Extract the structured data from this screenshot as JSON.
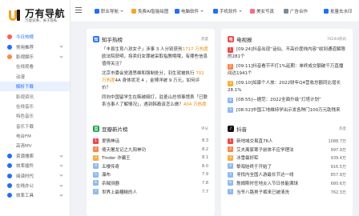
{
  "brand": {
    "title": "万有导航",
    "subtitle": "万能说事，关于隐私"
  },
  "sidebar": [
    {
      "label": "今日热榜",
      "color": "#ff5c5c",
      "kind": "top",
      "state": "active"
    },
    {
      "label": "常用推荐",
      "color": "#1e6fff",
      "kind": "top",
      "state": ""
    },
    {
      "label": "影视娱乐",
      "color": "#ff8a3d",
      "kind": "top",
      "state": ""
    },
    {
      "label": "在线观看",
      "kind": "sub",
      "state": ""
    },
    {
      "label": "动漫",
      "kind": "sub",
      "state": ""
    },
    {
      "label": "解析下载",
      "kind": "sub",
      "state": "highlight"
    },
    {
      "label": "影视资讯",
      "kind": "sub",
      "state": ""
    },
    {
      "label": "在线音乐",
      "kind": "sub",
      "state": ""
    },
    {
      "label": "特色音乐",
      "kind": "sub",
      "state": ""
    },
    {
      "label": "音乐下载",
      "kind": "sub",
      "state": ""
    },
    {
      "label": "电台FM",
      "kind": "sub",
      "state": ""
    },
    {
      "label": "高清MV",
      "kind": "sub",
      "state": ""
    },
    {
      "label": "资源搜索",
      "color": "#1e6fff",
      "kind": "top",
      "state": ""
    },
    {
      "label": "效率插件",
      "color": "#1e6fff",
      "kind": "top",
      "state": ""
    },
    {
      "label": "阅读时代",
      "color": "#1e6fff",
      "kind": "top",
      "state": ""
    },
    {
      "label": "在线办公",
      "color": "#1e6fff",
      "kind": "top",
      "state": ""
    },
    {
      "label": "效率工具",
      "color": "#1e6fff",
      "kind": "top",
      "state": ""
    }
  ],
  "nav": [
    {
      "label": "职业导航",
      "color": "#1e6fff",
      "caret": true
    },
    {
      "label": "免费AI智能绘图",
      "color": "#f5a623",
      "caret": false
    },
    {
      "label": "电脑软件",
      "color": "#1e6fff",
      "caret": true
    },
    {
      "label": "手机软件",
      "color": "#1e6fff",
      "caret": true
    },
    {
      "label": "美女写真",
      "color": "#ff6b8a",
      "caret": false
    },
    {
      "label": "广告合作",
      "color": "#7b8a9a",
      "caret": false
    },
    {
      "label": "批量去水印",
      "color": "#1e6fff",
      "caret": false
    }
  ],
  "zhihu": {
    "title": "知乎热榜",
    "meta": "热度",
    "icon": "知",
    "items": [
      {
        "text": "「丰县生育八孩女子」涉事 3 人分别获刑",
        "hot": "1717 万热度",
        "text2": "欧法院获明，拐卖妇女罪被采取指教哦哦，有哪些信息值得关注？"
      },
      {
        "text": "北京市委会党酒思维和强制处分，羽生就被执行 ",
        "hot": "702 万热度",
        "text2": "4A 身体状况 4 ，金博洋被 9 万元，如何评价？"
      },
      {
        "text": "同向中国留学生在韩被殴打，驻釜山总领事馆表「已联系当事人了解情况」，遇到韩裔该怎么做？",
        "hot": "404 万热度",
        "text2": ""
      }
    ]
  },
  "weibo": {
    "title": "电视报",
    "meta": "7X24H热讯",
    "icon": "电",
    "items": [
      {
        "n": "1",
        "text": "[09:24]抖音出现“话仙、不高价度线内容”收到通道解限的281个"
      },
      {
        "n": "2",
        "text": "[09:11]抖音看节不打1%延期：单终成交额破千万直播间达1941个"
      },
      {
        "n": "3",
        "text": "[09:10]如康个人放：2022财年Q4营收总额同比增长28.1%"
      },
      {
        "n": "4",
        "text": "[08:55]—据范：2022全面升级“灯塔计划”"
      },
      {
        "n": "5",
        "text": "[08:52]中国工地维持学出示发各种门100万元助残来"
      }
    ]
  },
  "douban": {
    "title": "豆瓣新片榜",
    "meta": "评分",
    "icon": "豆",
    "items": [
      {
        "n": "1",
        "text": "爱情神话",
        "score": "8.3"
      },
      {
        "n": "2",
        "text": "倚天屠龙记之九阳神功",
        "score": "8.2"
      },
      {
        "n": "3",
        "text": "Tinder 诈骗王",
        "score": "8.1"
      },
      {
        "n": "4",
        "text": "五楼传奇",
        "score": "8.0"
      },
      {
        "n": "5",
        "text": "瀑布",
        "score": "7.9"
      },
      {
        "n": "6",
        "text": "杀贼测器",
        "score": "7.8"
      },
      {
        "n": "7",
        "text": "世界上最糟糕的人",
        "score": "7.7"
      }
    ]
  },
  "douyin": {
    "title": "抖音",
    "meta": "热度",
    "icon": "♪",
    "items": [
      {
        "n": "1",
        "text": "新地域交易直76人",
        "score": "1088.7万"
      },
      {
        "n": "2",
        "text": "艾夫离家寒子前体不应学理法",
        "score": "997.9万"
      },
      {
        "n": "3",
        "text": "冰雪最好粽",
        "score": "939.4万"
      },
      {
        "n": "4",
        "text": "黎海娃终于开始了",
        "score": "916.5万"
      },
      {
        "n": "5",
        "text": "寻找内全国人游最长节达一线",
        "score": "857.9万"
      },
      {
        "n": "6",
        "text": "詹姆斯时任地炎入节日技能满球",
        "score": "680.6万"
      },
      {
        "n": "7",
        "text": "当爷八路男子裤来已被清洗",
        "score": "762.3万"
      }
    ]
  }
}
